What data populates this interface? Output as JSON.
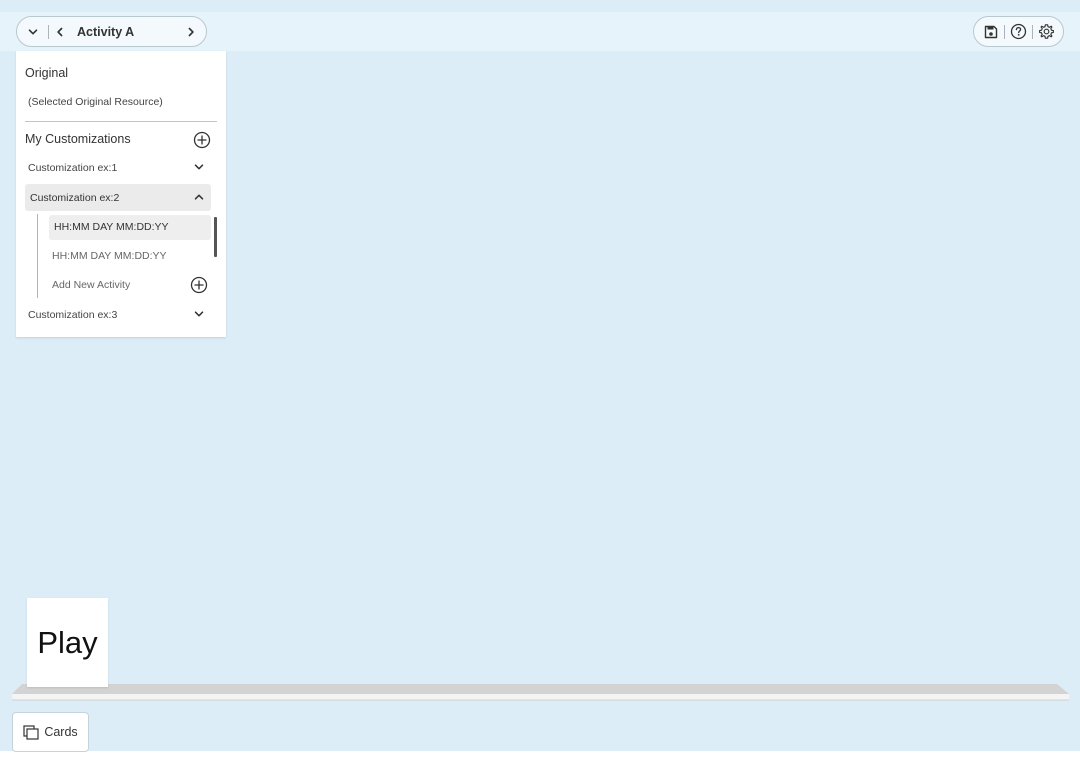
{
  "header": {
    "activity_title": "Activity A",
    "icons": {
      "collapse": "chevron-down-icon",
      "prev": "chevron-left-icon",
      "next": "chevron-right-icon",
      "save": "save-icon",
      "help": "help-icon",
      "settings": "gear-icon"
    }
  },
  "panel": {
    "original_heading": "Original",
    "original_resource": "(Selected Original Resource)",
    "customizations_heading": "My Customizations",
    "customizations": [
      {
        "label": "Customization ex:1",
        "expanded": false
      },
      {
        "label": "Customization ex:2",
        "expanded": true,
        "activities": [
          "HH:MM DAY MM:DD:YY",
          "HH:MM DAY MM:DD:YY"
        ],
        "add_label": "Add New Activity"
      },
      {
        "label": "Customization ex:3",
        "expanded": false
      }
    ]
  },
  "play_card": {
    "label": "Play"
  },
  "bottom": {
    "cards_label": "Cards"
  },
  "colors": {
    "background": "#dcedf7",
    "topbar": "#e6f3fa",
    "panel": "#ffffff",
    "selected_row": "#ebebeb"
  }
}
